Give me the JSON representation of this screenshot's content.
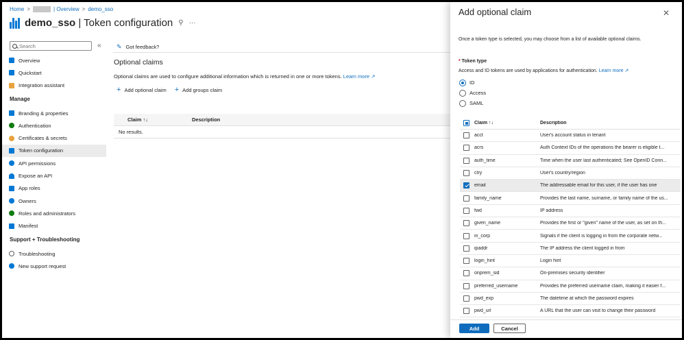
{
  "breadcrumb": {
    "home": "Home",
    "separator": ">",
    "overview": "| Overview",
    "app": "demo_sso"
  },
  "title": {
    "app": "demo_sso",
    "page": "| Token configuration"
  },
  "sidebar": {
    "search_placeholder": "Search",
    "items": [
      {
        "label": "Overview",
        "icon": "overview-icon",
        "color": "#0078d4"
      },
      {
        "label": "Quickstart",
        "icon": "quickstart-icon",
        "color": "#0078d4"
      },
      {
        "label": "Integration assistant",
        "icon": "rocket-icon",
        "color": "#e8a33d"
      }
    ],
    "manage_heading": "Manage",
    "manage_items": [
      {
        "label": "Branding & properties",
        "icon": "branding-icon",
        "color": "#0078d4"
      },
      {
        "label": "Authentication",
        "icon": "authentication-icon",
        "color": "#107c10"
      },
      {
        "label": "Certificates & secrets",
        "icon": "key-icon",
        "color": "#e8a33d"
      },
      {
        "label": "Token configuration",
        "icon": "token-icon",
        "color": "#0078d4",
        "active": true
      },
      {
        "label": "API permissions",
        "icon": "api-permissions-icon",
        "color": "#0078d4"
      },
      {
        "label": "Expose an API",
        "icon": "cloud-icon",
        "color": "#0078d4"
      },
      {
        "label": "App roles",
        "icon": "app-roles-icon",
        "color": "#0078d4"
      },
      {
        "label": "Owners",
        "icon": "owners-icon",
        "color": "#0078d4"
      },
      {
        "label": "Roles and administrators",
        "icon": "roles-icon",
        "color": "#107c10"
      },
      {
        "label": "Manifest",
        "icon": "manifest-icon",
        "color": "#0078d4"
      }
    ],
    "support_heading": "Support + Troubleshooting",
    "support_items": [
      {
        "label": "Troubleshooting",
        "icon": "wrench-icon",
        "color": "#616161"
      },
      {
        "label": "New support request",
        "icon": "support-icon",
        "color": "#0078d4"
      }
    ]
  },
  "main": {
    "feedback": "Got feedback?",
    "section_title": "Optional claims",
    "description": "Optional claims are used to configure additional information which is returned in one or more tokens.",
    "learn_more": "Learn more",
    "add_optional_claim": "Add optional claim",
    "add_groups_claim": "Add groups claim",
    "col_claim": "Claim ↑↓",
    "col_description": "Description",
    "no_results": "No results."
  },
  "panel": {
    "title": "Add optional claim",
    "intro": "Once a token type is selected, you may choose from a list of available optional claims.",
    "token_type_label": "Token type",
    "token_type_desc": "Access and ID tokens are used by applications for authentication.",
    "learn_more": "Learn more",
    "token_types": [
      "ID",
      "Access",
      "SAML"
    ],
    "selected_token_type": "ID",
    "col_claim": "Claim ↑↓",
    "col_description": "Description",
    "claims": [
      {
        "name": "acct",
        "desc": "User's account status in tenant",
        "checked": false
      },
      {
        "name": "acrs",
        "desc": "Auth Context IDs of the operations the bearer is eligible t...",
        "checked": false
      },
      {
        "name": "auth_time",
        "desc": "Time when the user last authenticated; See OpenID Conn...",
        "checked": false
      },
      {
        "name": "ctry",
        "desc": "User's country/region",
        "checked": false
      },
      {
        "name": "email",
        "desc": "The addressable email for this user, if the user has one",
        "checked": true
      },
      {
        "name": "family_name",
        "desc": "Provides the last name, surname, or family name of the us...",
        "checked": false
      },
      {
        "name": "fwd",
        "desc": "IP address",
        "checked": false
      },
      {
        "name": "given_name",
        "desc": "Provides the first or \"given\" name of the user, as set on th...",
        "checked": false
      },
      {
        "name": "in_corp",
        "desc": "Signals if the client is logging in from the corporate netw...",
        "checked": false
      },
      {
        "name": "ipaddr",
        "desc": "The IP address the client logged in from",
        "checked": false
      },
      {
        "name": "login_hint",
        "desc": "Login hint",
        "checked": false
      },
      {
        "name": "onprem_sid",
        "desc": "On-premises security identifier",
        "checked": false
      },
      {
        "name": "preferred_username",
        "desc": "Provides the preferred username claim, making it easier f...",
        "checked": false
      },
      {
        "name": "pwd_exp",
        "desc": "The datetime at which the password expires",
        "checked": false
      },
      {
        "name": "pwd_url",
        "desc": "A URL that the user can visit to change their password",
        "checked": false
      }
    ],
    "add_label": "Add",
    "cancel_label": "Cancel"
  }
}
